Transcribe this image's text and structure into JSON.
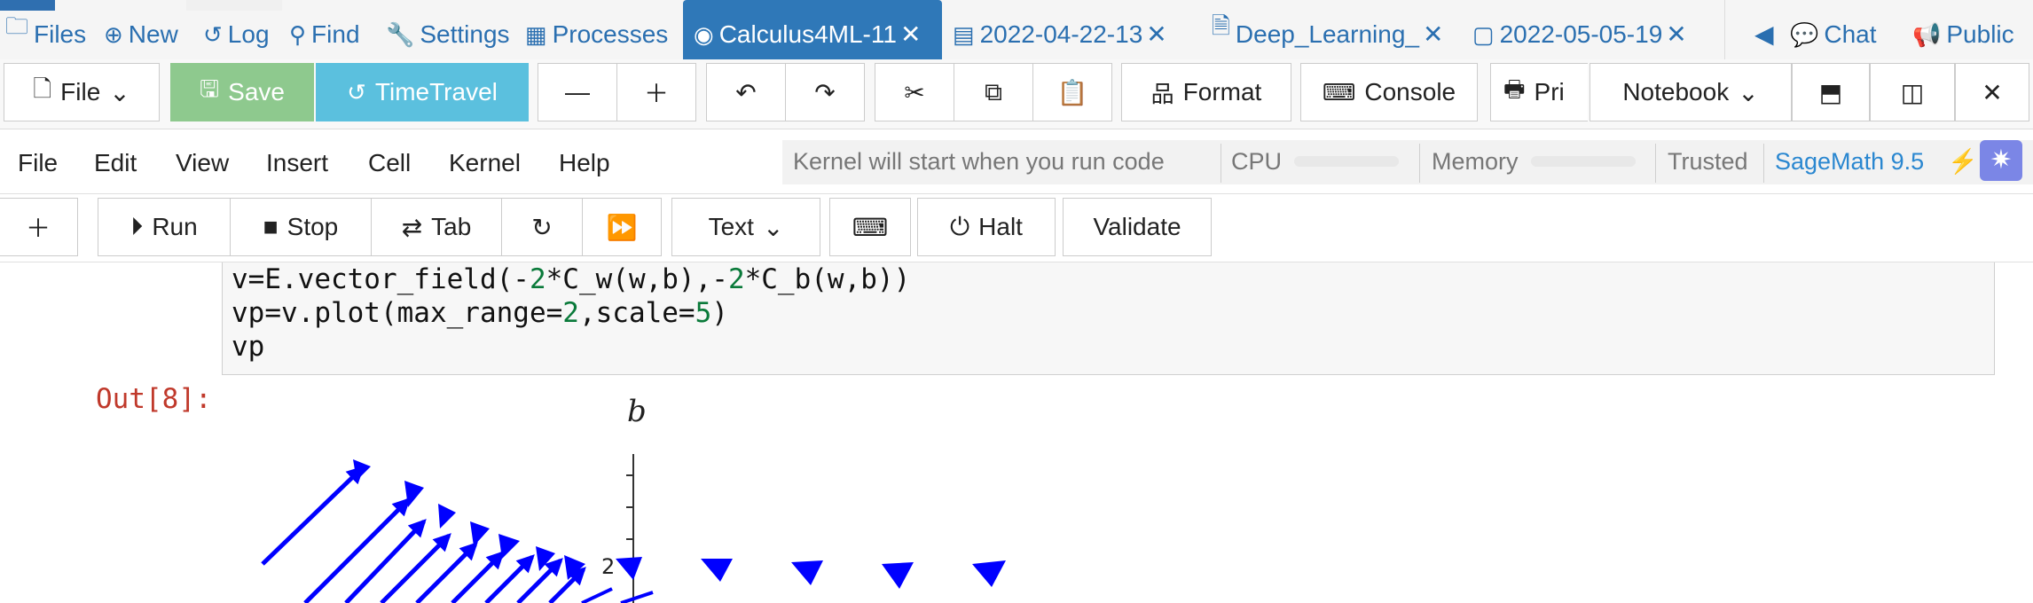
{
  "top_tabs": {
    "files": "Files",
    "new": "New",
    "log": "Log",
    "find": "Find",
    "settings": "Settings",
    "processes": "Processes",
    "active": "Calculus4ML-11",
    "t1": "2022-04-22-13",
    "t2": "Deep_Learning_",
    "t3": "2022-05-05-19",
    "chat": "Chat",
    "public": "Public"
  },
  "frame_toolbar": {
    "file": "File",
    "save": "Save",
    "timetravel": "TimeTravel",
    "format": "Format",
    "console": "Console",
    "print": "Pri",
    "notebook": "Notebook"
  },
  "menu": {
    "file": "File",
    "edit": "Edit",
    "view": "View",
    "insert": "Insert",
    "cell": "Cell",
    "kernel": "Kernel",
    "help": "Help"
  },
  "kernel_status": {
    "message": "Kernel will start when you run code",
    "cpu": "CPU",
    "memory": "Memory",
    "trusted": "Trusted",
    "kernel_name": "SageMath 9.5",
    "cpu_level": 0,
    "memory_level": 0
  },
  "cell_toolbar": {
    "run": "Run",
    "stop": "Stop",
    "tab": "Tab",
    "cell_type": "Text",
    "halt": "Halt",
    "validate": "Validate"
  },
  "code": {
    "line1_a": "v=E.vector_field(-",
    "line1_n1": "2",
    "line1_b": "*C_w(w,b),-",
    "line1_n2": "2",
    "line1_c": "*C_b(w,b))",
    "line2_a": "vp=v.plot(max_range=",
    "line2_n1": "2",
    "line2_b": ",scale=",
    "line2_n2": "5",
    "line2_c": ")",
    "line3": "vp"
  },
  "output": {
    "prompt": "Out[8]:"
  },
  "chart_data": {
    "type": "scatter",
    "title": "",
    "xlabel": "",
    "ylabel": "b",
    "y_tick_labels": [
      "2"
    ],
    "arrow_color": "#0000ff",
    "note_values": "vector field arrows (partially visible, cropped at bottom)"
  },
  "colors": {
    "accent": "#2f78b8",
    "save_bg": "#8ec98e",
    "timetravel_bg": "#5bc0de",
    "out_prompt": "#c0392b",
    "kernel_name": "#2a87d0"
  }
}
